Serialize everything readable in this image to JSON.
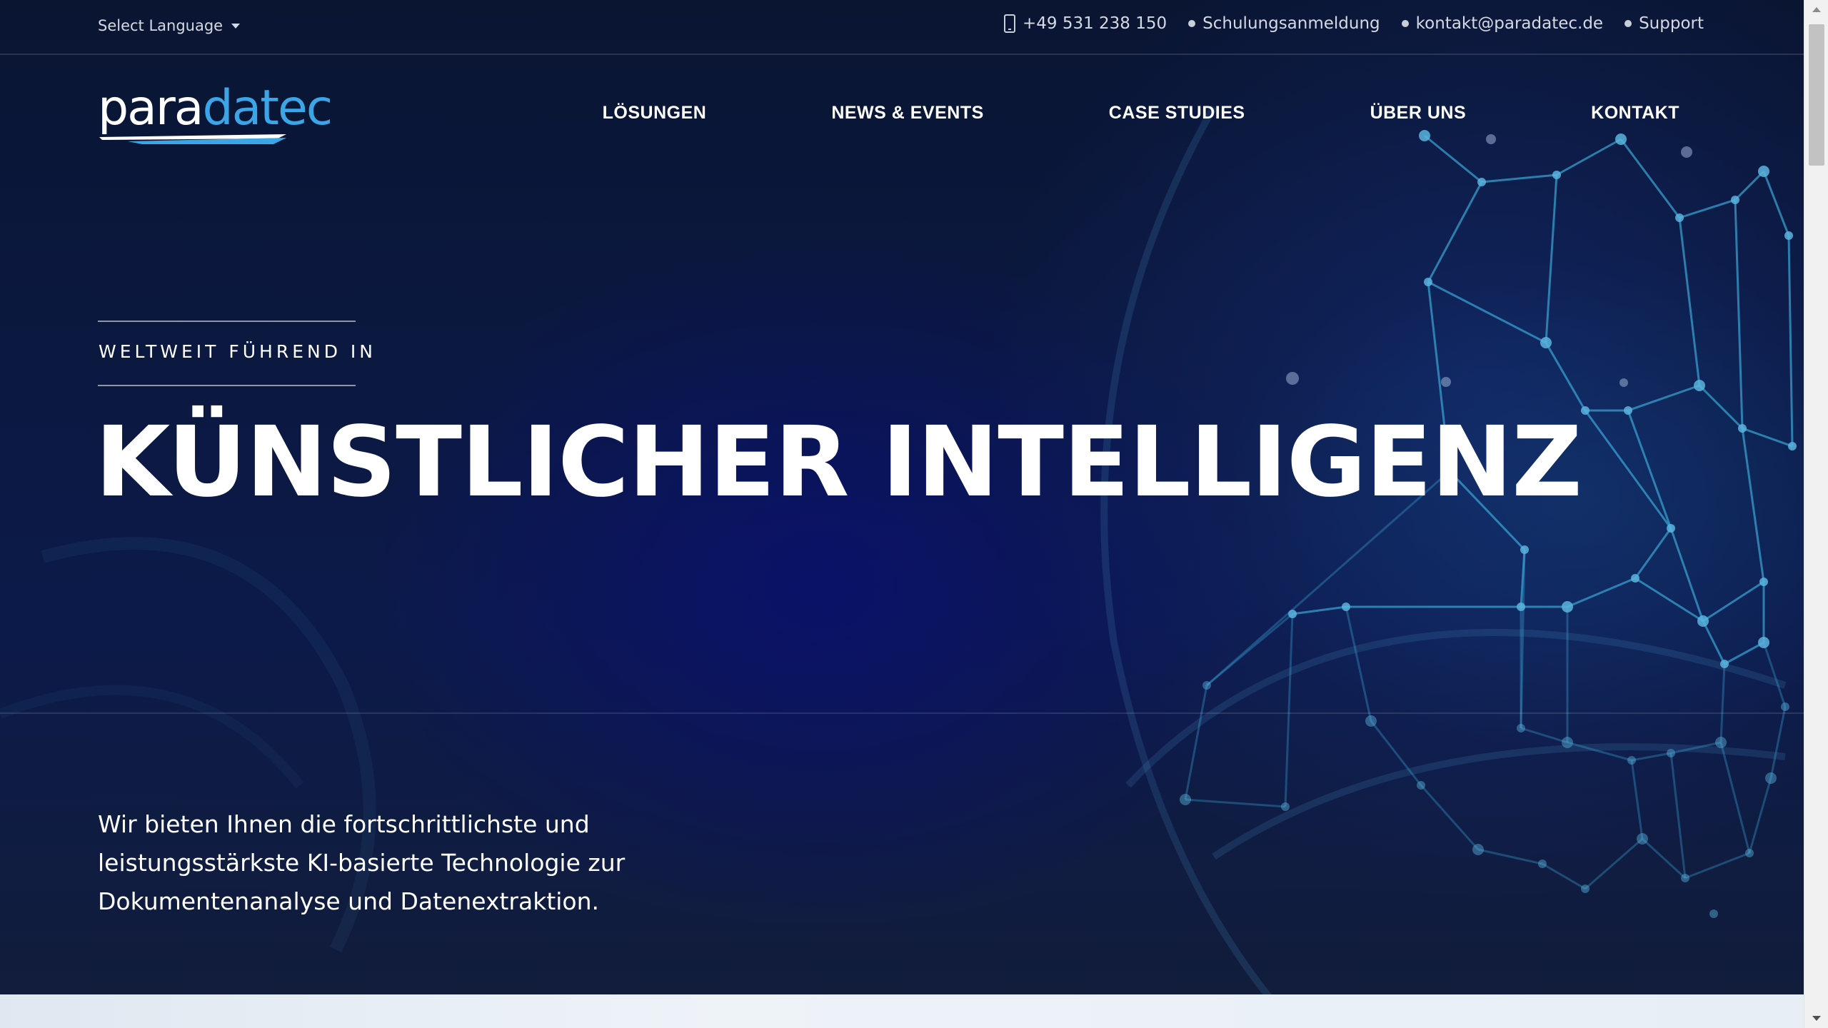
{
  "topbar": {
    "language_label": "Select Language",
    "phone": "+49 531 238 150",
    "training": "Schulungsanmeldung",
    "email": "kontakt@paradatec.de",
    "support": "Support"
  },
  "header": {
    "logo_part1": "para",
    "logo_part2": "datec",
    "nav": [
      {
        "label": "LÖSUNGEN"
      },
      {
        "label": "NEWS & EVENTS"
      },
      {
        "label": "CASE STUDIES"
      },
      {
        "label": "ÜBER UNS"
      },
      {
        "label": "KONTAKT"
      }
    ]
  },
  "hero": {
    "eyebrow": "WELTWEIT FÜHREND IN",
    "headline": "KÜNSTLICHER INTELLIGENZ",
    "lead": "Wir bieten Ihnen die fortschrittlichste und leistungsstärkste KI-basierte Technologie zur Dokumentenanalyse und Datenextraktion."
  },
  "colors": {
    "brand_blue": "#3aa6e8",
    "background": "#0b1840",
    "network": "#39a7d6"
  },
  "icons": {
    "phone": "mobile-phone-icon",
    "bullet": "dot-icon",
    "dropdown": "caret-down-icon"
  }
}
